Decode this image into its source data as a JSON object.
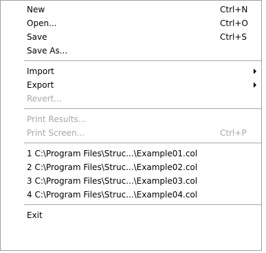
{
  "menu": {
    "groups": [
      [
        {
          "label": "New",
          "shortcut": "Ctrl+N"
        },
        {
          "label": "Open...",
          "shortcut": "Ctrl+O"
        },
        {
          "label": "Save",
          "shortcut": "Ctrl+S"
        },
        {
          "label": "Save As..."
        }
      ],
      [
        {
          "label": "Import",
          "submenu": true
        },
        {
          "label": "Export",
          "submenu": true
        },
        {
          "label": "Revert...",
          "disabled": true
        }
      ],
      [
        {
          "label": "Print Results...",
          "disabled": true
        },
        {
          "label": "Print Screen...",
          "shortcut": "Ctrl+P",
          "disabled": true
        }
      ],
      [
        {
          "label": "1 C:\\Program Files\\Struc...\\Example01.col"
        },
        {
          "label": "2 C:\\Program Files\\Struc...\\Example02.col"
        },
        {
          "label": "3 C:\\Program Files\\Struc...\\Example03.col"
        },
        {
          "label": "4 C:\\Program Files\\Struc...\\Example04.col"
        }
      ],
      [
        {
          "label": "Exit"
        }
      ]
    ],
    "colors": {
      "text": "#000000",
      "disabled_text": "#a7a6aa",
      "separator": "#a6a6a6",
      "border": "#9d9d9d",
      "background": "#ffffff"
    }
  }
}
